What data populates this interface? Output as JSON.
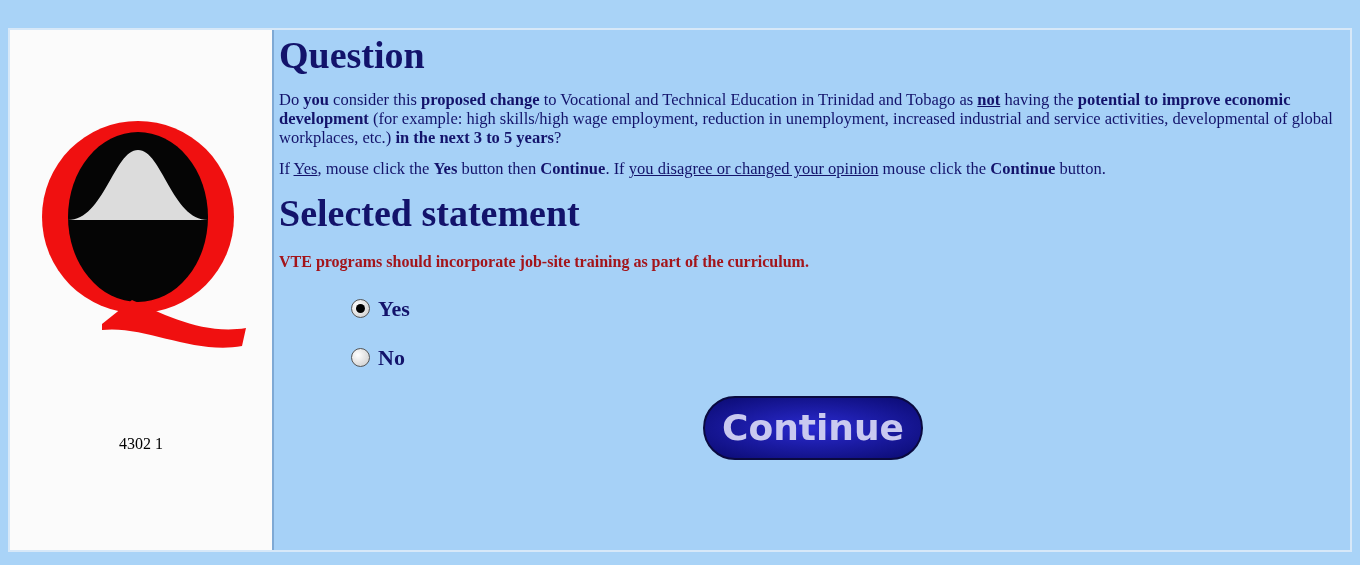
{
  "sidebar": {
    "code": "4302 1"
  },
  "question": {
    "heading": "Question",
    "paragraphs": [
      [
        {
          "text": "Do ",
          "kind": "plain"
        },
        {
          "text": "you",
          "kind": "bold"
        },
        {
          "text": " consider this ",
          "kind": "plain"
        },
        {
          "text": "proposed change",
          "kind": "bold"
        },
        {
          "text": " to Vocational and Technical Education in Trinidad and Tobago as ",
          "kind": "plain"
        },
        {
          "text": "not",
          "kind": "bold_underline"
        },
        {
          "text": " having the ",
          "kind": "plain"
        },
        {
          "text": "potential to improve economic development",
          "kind": "bold"
        },
        {
          "text": " (for example: high skills/high wage employment, reduction in unemployment, increased industrial and service activities, developmental of global workplaces, etc.) ",
          "kind": "plain"
        },
        {
          "text": "in the next 3 to 5 years",
          "kind": "bold"
        },
        {
          "text": "?",
          "kind": "plain"
        }
      ],
      [
        {
          "text": "If ",
          "kind": "plain"
        },
        {
          "text": "Yes",
          "kind": "underline"
        },
        {
          "text": ", mouse click the ",
          "kind": "plain"
        },
        {
          "text": "Yes",
          "kind": "bold"
        },
        {
          "text": " button then ",
          "kind": "plain"
        },
        {
          "text": "Continue",
          "kind": "bold"
        },
        {
          "text": ". If ",
          "kind": "plain"
        },
        {
          "text": "you disagree or changed your opinion",
          "kind": "underline"
        },
        {
          "text": " mouse click the ",
          "kind": "plain"
        },
        {
          "text": "Continue",
          "kind": "bold"
        },
        {
          "text": " button.",
          "kind": "plain"
        }
      ]
    ]
  },
  "statement": {
    "heading": "Selected statement",
    "text": "VTE programs should incorporate job-site training as part of the curriculum."
  },
  "options": [
    {
      "label": "Yes",
      "selected": true
    },
    {
      "label": "No",
      "selected": false
    }
  ],
  "continue_button": "Continue"
}
